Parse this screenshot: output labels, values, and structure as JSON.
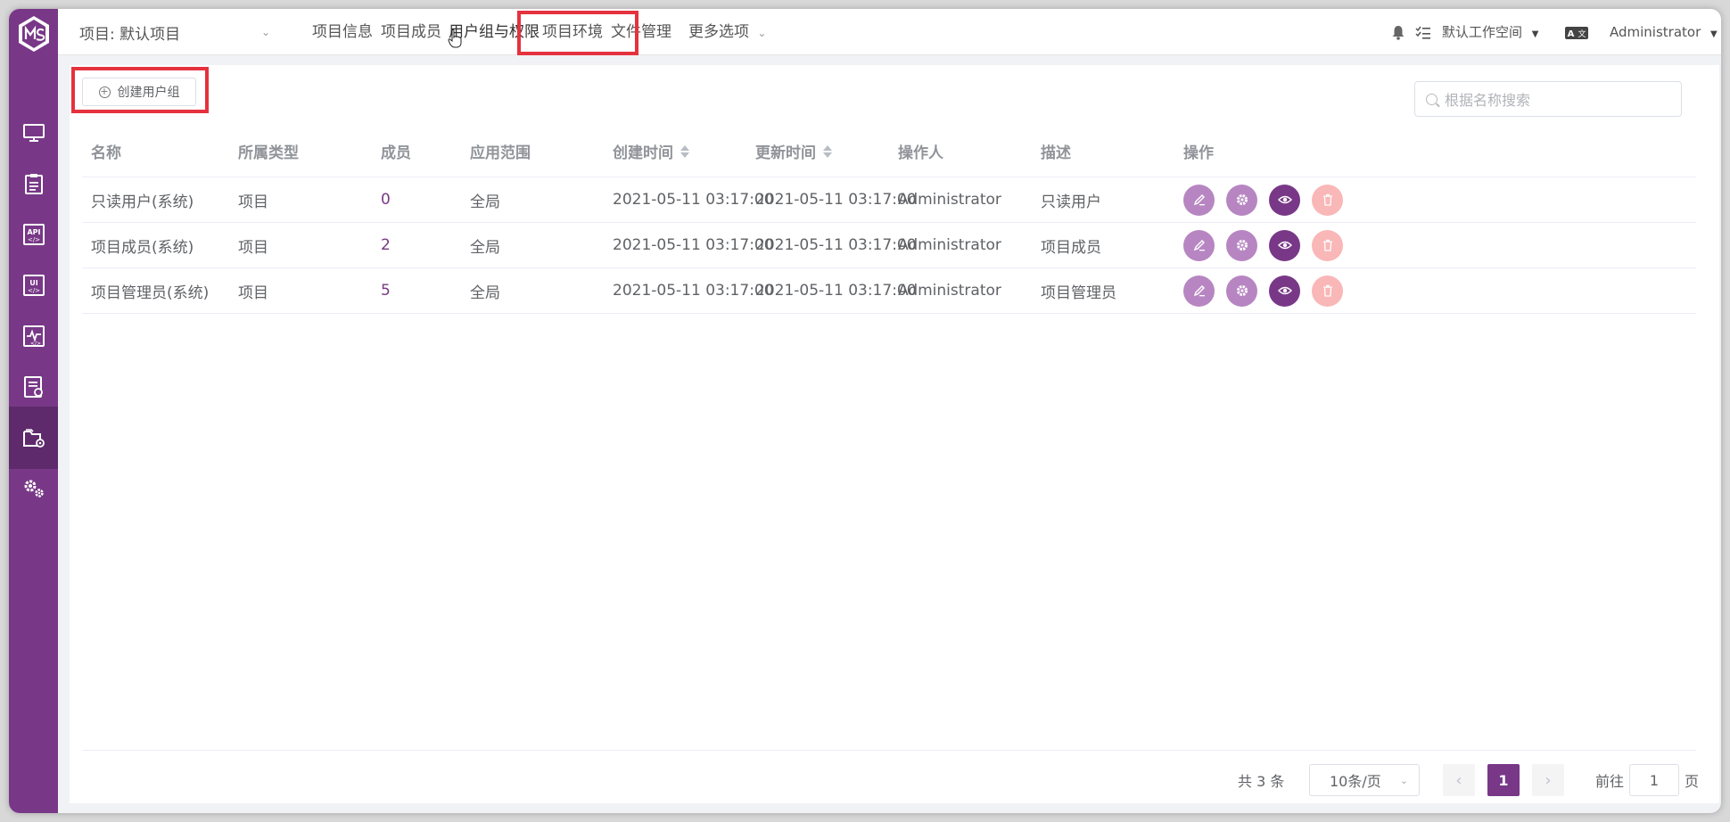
{
  "topbar": {
    "project_label": "项目: 默认项目",
    "nav": [
      "项目信息",
      "项目成员",
      "用户组与权限",
      "项目环境",
      "文件管理"
    ],
    "more_label": "更多选项",
    "workspace_label": "默认工作空间",
    "user_label": "Administrator"
  },
  "toolbar": {
    "create_label": "创建用户组",
    "search_placeholder": "根据名称搜索"
  },
  "table": {
    "headers": [
      "名称",
      "所属类型",
      "成员",
      "应用范围",
      "创建时间",
      "更新时间",
      "操作人",
      "描述",
      "操作"
    ],
    "rows": [
      {
        "name": "只读用户(系统)",
        "type": "项目",
        "members": "0",
        "scope": "全局",
        "created": "2021-05-11 03:17:00",
        "updated": "2021-05-11 03:17:00",
        "operator": "Administrator",
        "desc": "只读用户"
      },
      {
        "name": "项目成员(系统)",
        "type": "项目",
        "members": "2",
        "scope": "全局",
        "created": "2021-05-11 03:17:00",
        "updated": "2021-05-11 03:17:00",
        "operator": "Administrator",
        "desc": "项目成员"
      },
      {
        "name": "项目管理员(系统)",
        "type": "项目",
        "members": "5",
        "scope": "全局",
        "created": "2021-05-11 03:17:00",
        "updated": "2021-05-11 03:17:00",
        "operator": "Administrator",
        "desc": "项目管理员"
      }
    ]
  },
  "pagination": {
    "total_label": "共 3 条",
    "page_size_label": "10条/页",
    "current_page": "1",
    "goto_prefix": "前往",
    "goto_value": "1",
    "goto_suffix": "页"
  },
  "colors": {
    "brand": "#783887",
    "highlight": "#e5323e"
  }
}
